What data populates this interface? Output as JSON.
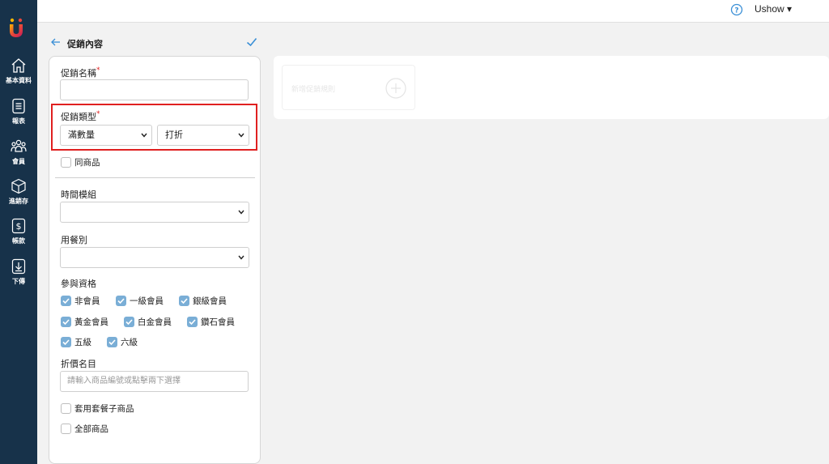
{
  "sidebar": {
    "items": [
      {
        "icon": "home-icon",
        "label": "基本資料"
      },
      {
        "icon": "report-icon",
        "label": "報表"
      },
      {
        "icon": "members-icon",
        "label": "會員"
      },
      {
        "icon": "box-icon",
        "label": "進銷存"
      },
      {
        "icon": "dollar-icon",
        "label": "帳款"
      },
      {
        "icon": "download-icon",
        "label": "下傳"
      }
    ]
  },
  "topbar": {
    "user": "Ushow ▾"
  },
  "header": {
    "title": "促銷內容"
  },
  "form": {
    "name_label": "促銷名稱",
    "required_mark": "*",
    "name_value": "",
    "type_label": "促銷類型",
    "type_select_1": "滿數量",
    "type_select_2": "打折",
    "same_product_label": "同商品",
    "time_template_label": "時間模組",
    "time_template_value": "",
    "meal_type_label": "用餐別",
    "meal_type_value": "",
    "eligibility_label": "參與資格",
    "eligibility": [
      {
        "label": "非會員",
        "checked": true
      },
      {
        "label": "一級會員",
        "checked": true
      },
      {
        "label": "銀級會員",
        "checked": true
      },
      {
        "label": "黃金會員",
        "checked": true
      },
      {
        "label": "白金會員",
        "checked": true
      },
      {
        "label": "鑽石會員",
        "checked": true
      },
      {
        "label": "五級",
        "checked": true
      },
      {
        "label": "六級",
        "checked": true
      }
    ],
    "discount_items_label": "折價名目",
    "discount_items_placeholder": "請輸入商品編號或點擊兩下選擇",
    "apply_combo_label": "套用套餐子商品",
    "all_products_label": "全部商品"
  },
  "rules": {
    "add_label": "新增促銷規則"
  },
  "colors": {
    "sidebar_bg": "#17324a",
    "accent": "#3a8fd6",
    "highlight": "#e02020",
    "checkbox_checked": "#7aaed6"
  }
}
